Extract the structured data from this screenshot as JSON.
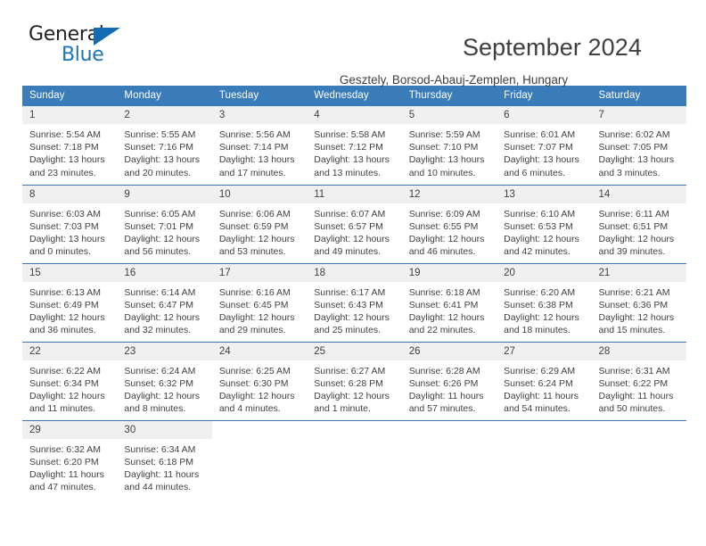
{
  "brand": {
    "name_part1": "General",
    "name_part2": "Blue",
    "accent_color": "#1b75bb",
    "triangle_color": "#136cb2"
  },
  "header": {
    "title": "September 2024",
    "subtitle": "Gesztely, Borsod-Abauj-Zemplen, Hungary",
    "header_bg_color": "#3a7cba",
    "daynum_bg_color": "#f0f0f0"
  },
  "calendar": {
    "weekday_headers": [
      "Sunday",
      "Monday",
      "Tuesday",
      "Wednesday",
      "Thursday",
      "Friday",
      "Saturday"
    ],
    "weeks": [
      [
        {
          "day": "1",
          "sunrise": "Sunrise: 5:54 AM",
          "sunset": "Sunset: 7:18 PM",
          "daylight_line1": "Daylight: 13 hours",
          "daylight_line2": "and 23 minutes."
        },
        {
          "day": "2",
          "sunrise": "Sunrise: 5:55 AM",
          "sunset": "Sunset: 7:16 PM",
          "daylight_line1": "Daylight: 13 hours",
          "daylight_line2": "and 20 minutes."
        },
        {
          "day": "3",
          "sunrise": "Sunrise: 5:56 AM",
          "sunset": "Sunset: 7:14 PM",
          "daylight_line1": "Daylight: 13 hours",
          "daylight_line2": "and 17 minutes."
        },
        {
          "day": "4",
          "sunrise": "Sunrise: 5:58 AM",
          "sunset": "Sunset: 7:12 PM",
          "daylight_line1": "Daylight: 13 hours",
          "daylight_line2": "and 13 minutes."
        },
        {
          "day": "5",
          "sunrise": "Sunrise: 5:59 AM",
          "sunset": "Sunset: 7:10 PM",
          "daylight_line1": "Daylight: 13 hours",
          "daylight_line2": "and 10 minutes."
        },
        {
          "day": "6",
          "sunrise": "Sunrise: 6:01 AM",
          "sunset": "Sunset: 7:07 PM",
          "daylight_line1": "Daylight: 13 hours",
          "daylight_line2": "and 6 minutes."
        },
        {
          "day": "7",
          "sunrise": "Sunrise: 6:02 AM",
          "sunset": "Sunset: 7:05 PM",
          "daylight_line1": "Daylight: 13 hours",
          "daylight_line2": "and 3 minutes."
        }
      ],
      [
        {
          "day": "8",
          "sunrise": "Sunrise: 6:03 AM",
          "sunset": "Sunset: 7:03 PM",
          "daylight_line1": "Daylight: 13 hours",
          "daylight_line2": "and 0 minutes."
        },
        {
          "day": "9",
          "sunrise": "Sunrise: 6:05 AM",
          "sunset": "Sunset: 7:01 PM",
          "daylight_line1": "Daylight: 12 hours",
          "daylight_line2": "and 56 minutes."
        },
        {
          "day": "10",
          "sunrise": "Sunrise: 6:06 AM",
          "sunset": "Sunset: 6:59 PM",
          "daylight_line1": "Daylight: 12 hours",
          "daylight_line2": "and 53 minutes."
        },
        {
          "day": "11",
          "sunrise": "Sunrise: 6:07 AM",
          "sunset": "Sunset: 6:57 PM",
          "daylight_line1": "Daylight: 12 hours",
          "daylight_line2": "and 49 minutes."
        },
        {
          "day": "12",
          "sunrise": "Sunrise: 6:09 AM",
          "sunset": "Sunset: 6:55 PM",
          "daylight_line1": "Daylight: 12 hours",
          "daylight_line2": "and 46 minutes."
        },
        {
          "day": "13",
          "sunrise": "Sunrise: 6:10 AM",
          "sunset": "Sunset: 6:53 PM",
          "daylight_line1": "Daylight: 12 hours",
          "daylight_line2": "and 42 minutes."
        },
        {
          "day": "14",
          "sunrise": "Sunrise: 6:11 AM",
          "sunset": "Sunset: 6:51 PM",
          "daylight_line1": "Daylight: 12 hours",
          "daylight_line2": "and 39 minutes."
        }
      ],
      [
        {
          "day": "15",
          "sunrise": "Sunrise: 6:13 AM",
          "sunset": "Sunset: 6:49 PM",
          "daylight_line1": "Daylight: 12 hours",
          "daylight_line2": "and 36 minutes."
        },
        {
          "day": "16",
          "sunrise": "Sunrise: 6:14 AM",
          "sunset": "Sunset: 6:47 PM",
          "daylight_line1": "Daylight: 12 hours",
          "daylight_line2": "and 32 minutes."
        },
        {
          "day": "17",
          "sunrise": "Sunrise: 6:16 AM",
          "sunset": "Sunset: 6:45 PM",
          "daylight_line1": "Daylight: 12 hours",
          "daylight_line2": "and 29 minutes."
        },
        {
          "day": "18",
          "sunrise": "Sunrise: 6:17 AM",
          "sunset": "Sunset: 6:43 PM",
          "daylight_line1": "Daylight: 12 hours",
          "daylight_line2": "and 25 minutes."
        },
        {
          "day": "19",
          "sunrise": "Sunrise: 6:18 AM",
          "sunset": "Sunset: 6:41 PM",
          "daylight_line1": "Daylight: 12 hours",
          "daylight_line2": "and 22 minutes."
        },
        {
          "day": "20",
          "sunrise": "Sunrise: 6:20 AM",
          "sunset": "Sunset: 6:38 PM",
          "daylight_line1": "Daylight: 12 hours",
          "daylight_line2": "and 18 minutes."
        },
        {
          "day": "21",
          "sunrise": "Sunrise: 6:21 AM",
          "sunset": "Sunset: 6:36 PM",
          "daylight_line1": "Daylight: 12 hours",
          "daylight_line2": "and 15 minutes."
        }
      ],
      [
        {
          "day": "22",
          "sunrise": "Sunrise: 6:22 AM",
          "sunset": "Sunset: 6:34 PM",
          "daylight_line1": "Daylight: 12 hours",
          "daylight_line2": "and 11 minutes."
        },
        {
          "day": "23",
          "sunrise": "Sunrise: 6:24 AM",
          "sunset": "Sunset: 6:32 PM",
          "daylight_line1": "Daylight: 12 hours",
          "daylight_line2": "and 8 minutes."
        },
        {
          "day": "24",
          "sunrise": "Sunrise: 6:25 AM",
          "sunset": "Sunset: 6:30 PM",
          "daylight_line1": "Daylight: 12 hours",
          "daylight_line2": "and 4 minutes."
        },
        {
          "day": "25",
          "sunrise": "Sunrise: 6:27 AM",
          "sunset": "Sunset: 6:28 PM",
          "daylight_line1": "Daylight: 12 hours",
          "daylight_line2": "and 1 minute."
        },
        {
          "day": "26",
          "sunrise": "Sunrise: 6:28 AM",
          "sunset": "Sunset: 6:26 PM",
          "daylight_line1": "Daylight: 11 hours",
          "daylight_line2": "and 57 minutes."
        },
        {
          "day": "27",
          "sunrise": "Sunrise: 6:29 AM",
          "sunset": "Sunset: 6:24 PM",
          "daylight_line1": "Daylight: 11 hours",
          "daylight_line2": "and 54 minutes."
        },
        {
          "day": "28",
          "sunrise": "Sunrise: 6:31 AM",
          "sunset": "Sunset: 6:22 PM",
          "daylight_line1": "Daylight: 11 hours",
          "daylight_line2": "and 50 minutes."
        }
      ],
      [
        {
          "day": "29",
          "sunrise": "Sunrise: 6:32 AM",
          "sunset": "Sunset: 6:20 PM",
          "daylight_line1": "Daylight: 11 hours",
          "daylight_line2": "and 47 minutes."
        },
        {
          "day": "30",
          "sunrise": "Sunrise: 6:34 AM",
          "sunset": "Sunset: 6:18 PM",
          "daylight_line1": "Daylight: 11 hours",
          "daylight_line2": "and 44 minutes."
        },
        {
          "day": "",
          "sunrise": "",
          "sunset": "",
          "daylight_line1": "",
          "daylight_line2": ""
        },
        {
          "day": "",
          "sunrise": "",
          "sunset": "",
          "daylight_line1": "",
          "daylight_line2": ""
        },
        {
          "day": "",
          "sunrise": "",
          "sunset": "",
          "daylight_line1": "",
          "daylight_line2": ""
        },
        {
          "day": "",
          "sunrise": "",
          "sunset": "",
          "daylight_line1": "",
          "daylight_line2": ""
        },
        {
          "day": "",
          "sunrise": "",
          "sunset": "",
          "daylight_line1": "",
          "daylight_line2": ""
        }
      ]
    ]
  }
}
